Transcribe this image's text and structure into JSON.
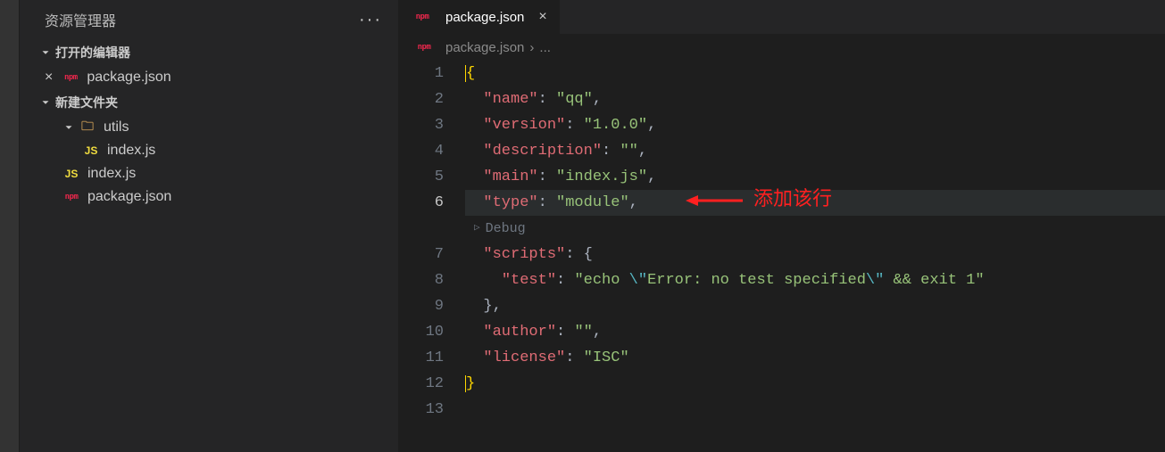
{
  "sidebar": {
    "title": "资源管理器",
    "openEditors": {
      "label": "打开的编辑器",
      "items": [
        {
          "name": "package.json",
          "iconText": "npm"
        }
      ]
    },
    "folder": {
      "label": "新建文件夹",
      "items": [
        {
          "name": "utils",
          "type": "folder",
          "indent": 2,
          "iconText": "📁"
        },
        {
          "name": "index.js",
          "type": "file",
          "indent": 3,
          "iconText": "JS",
          "iconClass": "js-icon"
        },
        {
          "name": "index.js",
          "type": "file",
          "indent": 2,
          "iconText": "JS",
          "iconClass": "js-icon"
        },
        {
          "name": "package.json",
          "type": "file",
          "indent": 2,
          "iconText": "npm",
          "iconClass": "npm-icon"
        }
      ]
    }
  },
  "editor": {
    "tab": {
      "name": "package.json",
      "iconText": "npm"
    },
    "breadcrumb": {
      "file": "package.json",
      "rest": "..."
    },
    "lineNumbers": [
      "1",
      "2",
      "3",
      "4",
      "5",
      "6",
      "",
      "7",
      "8",
      "9",
      "10",
      "11",
      "12",
      "13"
    ],
    "activeLine": "6",
    "codelens": "Debug",
    "json": {
      "name": {
        "k": "\"name\"",
        "v": "\"qq\""
      },
      "version": {
        "k": "\"version\"",
        "v": "\"1.0.0\""
      },
      "description": {
        "k": "\"description\"",
        "v": "\"\""
      },
      "main": {
        "k": "\"main\"",
        "v": "\"index.js\""
      },
      "type": {
        "k": "\"type\"",
        "v": "\"module\""
      },
      "scripts": {
        "k": "\"scripts\""
      },
      "test": {
        "k": "\"test\"",
        "v1": "\"echo ",
        "esc1": "\\\"",
        "v2": "Error: no test specified",
        "esc2": "\\\"",
        "v3": " && exit 1\""
      },
      "author": {
        "k": "\"author\"",
        "v": "\"\""
      },
      "license": {
        "k": "\"license\"",
        "v": "\"ISC\""
      }
    }
  },
  "annotation": {
    "text": "添加该行"
  }
}
